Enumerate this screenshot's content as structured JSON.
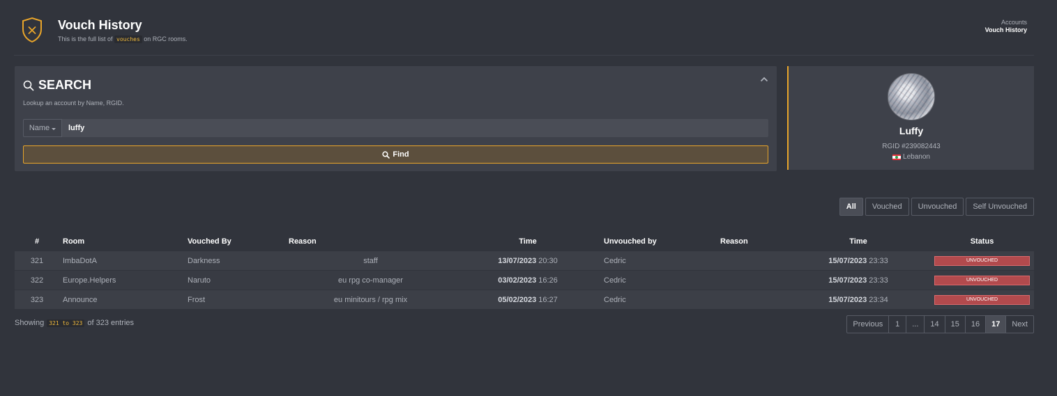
{
  "header": {
    "title": "Vouch History",
    "subtitle_pre": "This is the full list of",
    "subtitle_code": "vouches",
    "subtitle_post": "on RGC rooms.",
    "breadcrumb_parent": "Accounts",
    "breadcrumb_current": "Vouch History",
    "icon": "shield-icon",
    "accent_color": "#e9a52a"
  },
  "search": {
    "title": "SEARCH",
    "description": "Lookup an account by Name, RGID.",
    "type_label": "Name",
    "value": "luffy",
    "find_label": "Find"
  },
  "profile": {
    "name": "Luffy",
    "rgid": "RGID #239082443",
    "country": "Lebanon"
  },
  "filters": [
    "All",
    "Vouched",
    "Unvouched",
    "Self Unvouched"
  ],
  "active_filter": "All",
  "table": {
    "headers": {
      "num": "#",
      "room": "Room",
      "vouched_by": "Vouched By",
      "reason": "Reason",
      "time": "Time",
      "unvouched_by": "Unvouched by",
      "reason2": "Reason",
      "time2": "Time",
      "status": "Status"
    },
    "rows": [
      {
        "num": "321",
        "room": "ImbaDotA",
        "vouched_by": "Darkness",
        "reason": "staff",
        "time_date": "13/07/2023",
        "time_clock": "20:30",
        "unvouched_by": "Cedric",
        "reason2": "",
        "time2_date": "15/07/2023",
        "time2_clock": "23:33",
        "status": "UNVOUCHED"
      },
      {
        "num": "322",
        "room": "Europe.Helpers",
        "vouched_by": "Naruto",
        "reason": "eu rpg co-manager",
        "time_date": "03/02/2023",
        "time_clock": "16:26",
        "unvouched_by": "Cedric",
        "reason2": "",
        "time2_date": "15/07/2023",
        "time2_clock": "23:33",
        "status": "UNVOUCHED"
      },
      {
        "num": "323",
        "room": "Announce",
        "vouched_by": "Frost",
        "reason": "eu minitours / rpg mix",
        "time_date": "05/02/2023",
        "time_clock": "16:27",
        "unvouched_by": "Cedric",
        "reason2": "",
        "time2_date": "15/07/2023",
        "time2_clock": "23:34",
        "status": "UNVOUCHED"
      }
    ]
  },
  "footer": {
    "showing_pre": "Showing",
    "showing_range": "321 to 323",
    "showing_post": "of 323 entries"
  },
  "pagination": {
    "previous": "Previous",
    "pages": [
      "1",
      "...",
      "14",
      "15",
      "16",
      "17"
    ],
    "active_page": "17",
    "next": "Next"
  }
}
